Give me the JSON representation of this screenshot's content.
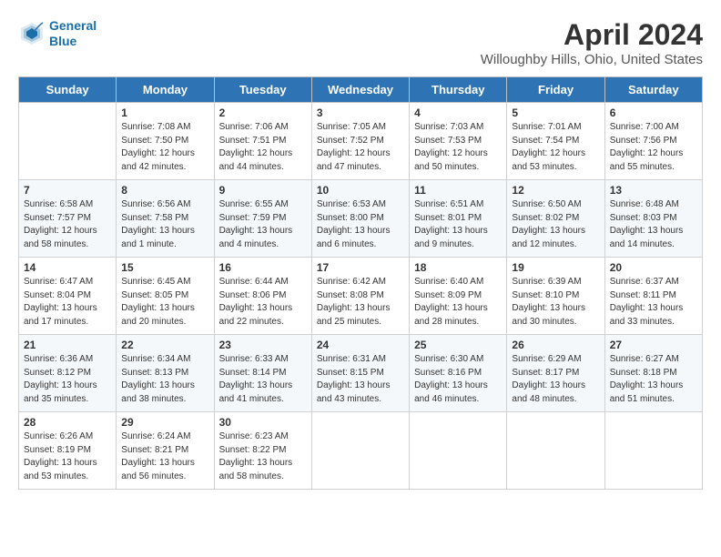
{
  "header": {
    "logo_line1": "General",
    "logo_line2": "Blue",
    "title": "April 2024",
    "subtitle": "Willoughby Hills, Ohio, United States"
  },
  "days_of_week": [
    "Sunday",
    "Monday",
    "Tuesday",
    "Wednesday",
    "Thursday",
    "Friday",
    "Saturday"
  ],
  "weeks": [
    [
      {
        "num": "",
        "info": ""
      },
      {
        "num": "1",
        "info": "Sunrise: 7:08 AM\nSunset: 7:50 PM\nDaylight: 12 hours\nand 42 minutes."
      },
      {
        "num": "2",
        "info": "Sunrise: 7:06 AM\nSunset: 7:51 PM\nDaylight: 12 hours\nand 44 minutes."
      },
      {
        "num": "3",
        "info": "Sunrise: 7:05 AM\nSunset: 7:52 PM\nDaylight: 12 hours\nand 47 minutes."
      },
      {
        "num": "4",
        "info": "Sunrise: 7:03 AM\nSunset: 7:53 PM\nDaylight: 12 hours\nand 50 minutes."
      },
      {
        "num": "5",
        "info": "Sunrise: 7:01 AM\nSunset: 7:54 PM\nDaylight: 12 hours\nand 53 minutes."
      },
      {
        "num": "6",
        "info": "Sunrise: 7:00 AM\nSunset: 7:56 PM\nDaylight: 12 hours\nand 55 minutes."
      }
    ],
    [
      {
        "num": "7",
        "info": "Sunrise: 6:58 AM\nSunset: 7:57 PM\nDaylight: 12 hours\nand 58 minutes."
      },
      {
        "num": "8",
        "info": "Sunrise: 6:56 AM\nSunset: 7:58 PM\nDaylight: 13 hours\nand 1 minute."
      },
      {
        "num": "9",
        "info": "Sunrise: 6:55 AM\nSunset: 7:59 PM\nDaylight: 13 hours\nand 4 minutes."
      },
      {
        "num": "10",
        "info": "Sunrise: 6:53 AM\nSunset: 8:00 PM\nDaylight: 13 hours\nand 6 minutes."
      },
      {
        "num": "11",
        "info": "Sunrise: 6:51 AM\nSunset: 8:01 PM\nDaylight: 13 hours\nand 9 minutes."
      },
      {
        "num": "12",
        "info": "Sunrise: 6:50 AM\nSunset: 8:02 PM\nDaylight: 13 hours\nand 12 minutes."
      },
      {
        "num": "13",
        "info": "Sunrise: 6:48 AM\nSunset: 8:03 PM\nDaylight: 13 hours\nand 14 minutes."
      }
    ],
    [
      {
        "num": "14",
        "info": "Sunrise: 6:47 AM\nSunset: 8:04 PM\nDaylight: 13 hours\nand 17 minutes."
      },
      {
        "num": "15",
        "info": "Sunrise: 6:45 AM\nSunset: 8:05 PM\nDaylight: 13 hours\nand 20 minutes."
      },
      {
        "num": "16",
        "info": "Sunrise: 6:44 AM\nSunset: 8:06 PM\nDaylight: 13 hours\nand 22 minutes."
      },
      {
        "num": "17",
        "info": "Sunrise: 6:42 AM\nSunset: 8:08 PM\nDaylight: 13 hours\nand 25 minutes."
      },
      {
        "num": "18",
        "info": "Sunrise: 6:40 AM\nSunset: 8:09 PM\nDaylight: 13 hours\nand 28 minutes."
      },
      {
        "num": "19",
        "info": "Sunrise: 6:39 AM\nSunset: 8:10 PM\nDaylight: 13 hours\nand 30 minutes."
      },
      {
        "num": "20",
        "info": "Sunrise: 6:37 AM\nSunset: 8:11 PM\nDaylight: 13 hours\nand 33 minutes."
      }
    ],
    [
      {
        "num": "21",
        "info": "Sunrise: 6:36 AM\nSunset: 8:12 PM\nDaylight: 13 hours\nand 35 minutes."
      },
      {
        "num": "22",
        "info": "Sunrise: 6:34 AM\nSunset: 8:13 PM\nDaylight: 13 hours\nand 38 minutes."
      },
      {
        "num": "23",
        "info": "Sunrise: 6:33 AM\nSunset: 8:14 PM\nDaylight: 13 hours\nand 41 minutes."
      },
      {
        "num": "24",
        "info": "Sunrise: 6:31 AM\nSunset: 8:15 PM\nDaylight: 13 hours\nand 43 minutes."
      },
      {
        "num": "25",
        "info": "Sunrise: 6:30 AM\nSunset: 8:16 PM\nDaylight: 13 hours\nand 46 minutes."
      },
      {
        "num": "26",
        "info": "Sunrise: 6:29 AM\nSunset: 8:17 PM\nDaylight: 13 hours\nand 48 minutes."
      },
      {
        "num": "27",
        "info": "Sunrise: 6:27 AM\nSunset: 8:18 PM\nDaylight: 13 hours\nand 51 minutes."
      }
    ],
    [
      {
        "num": "28",
        "info": "Sunrise: 6:26 AM\nSunset: 8:19 PM\nDaylight: 13 hours\nand 53 minutes."
      },
      {
        "num": "29",
        "info": "Sunrise: 6:24 AM\nSunset: 8:21 PM\nDaylight: 13 hours\nand 56 minutes."
      },
      {
        "num": "30",
        "info": "Sunrise: 6:23 AM\nSunset: 8:22 PM\nDaylight: 13 hours\nand 58 minutes."
      },
      {
        "num": "",
        "info": ""
      },
      {
        "num": "",
        "info": ""
      },
      {
        "num": "",
        "info": ""
      },
      {
        "num": "",
        "info": ""
      }
    ]
  ]
}
